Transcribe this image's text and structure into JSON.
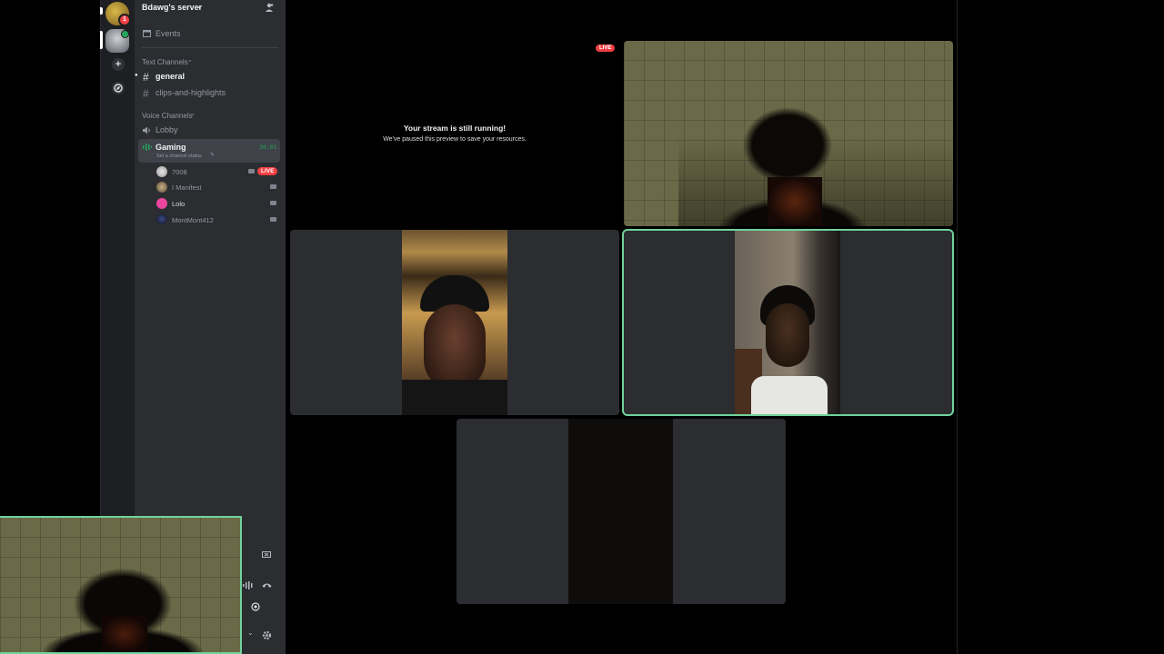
{
  "server": {
    "name": "Bdawg's server",
    "notification_count": "1"
  },
  "sidebar": {
    "events_label": "Events",
    "text_category": "Text Channels",
    "text_channels": [
      "general",
      "clips-and-highlights"
    ],
    "voice_category": "Voice Channels",
    "voice_channels": [
      {
        "name": "Lobby"
      },
      {
        "name": "Gaming",
        "timer": "38:01",
        "status_placeholder": "Set a channel status"
      }
    ],
    "voice_users": [
      {
        "name": "7008",
        "live": "LIVE"
      },
      {
        "name": "I Manifest"
      },
      {
        "name": "Lolo"
      },
      {
        "name": "MontMont412"
      }
    ]
  },
  "stage": {
    "live_badge": "LIVE",
    "paused_title": "Your stream is still running!",
    "paused_subtitle": "We've paused this preview to save your resources."
  },
  "colors": {
    "accent_green": "#23a55a",
    "live_red": "#f23f43",
    "speaking_outline": "#6fd39b"
  }
}
